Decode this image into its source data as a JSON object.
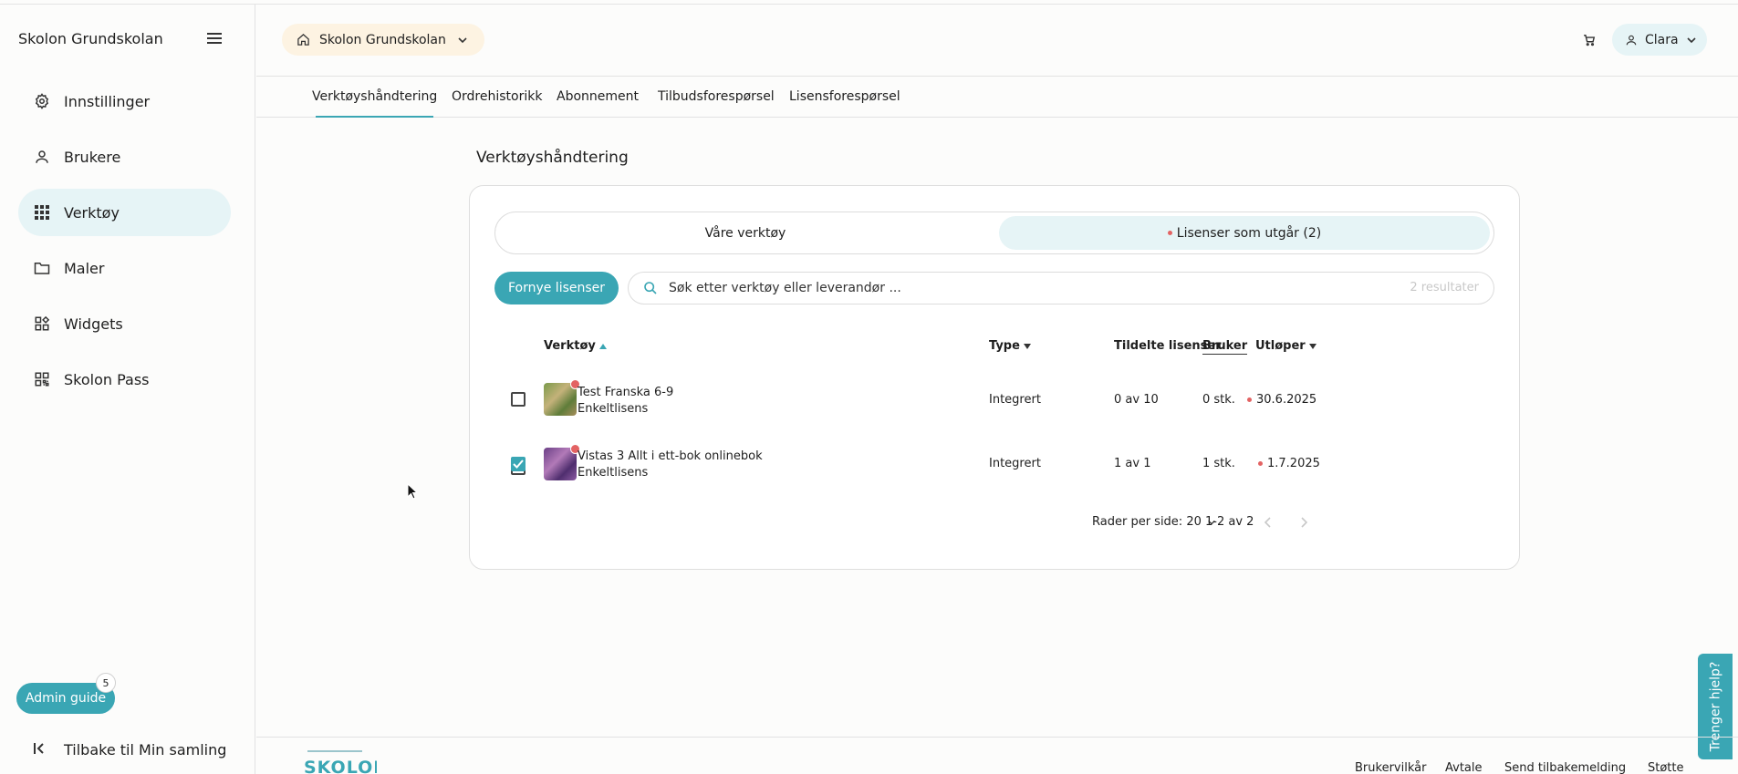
{
  "sidebar": {
    "brand": "Skolon Grundskolan",
    "items": [
      {
        "label": "Innstillinger",
        "icon": "gear-icon"
      },
      {
        "label": "Brukere",
        "icon": "user-icon"
      },
      {
        "label": "Verktøy",
        "icon": "grid-icon",
        "active": true
      },
      {
        "label": "Maler",
        "icon": "folder-icon"
      },
      {
        "label": "Widgets",
        "icon": "widgets-icon"
      },
      {
        "label": "Skolon Pass",
        "icon": "qr-icon"
      }
    ],
    "admin_guide_label": "Admin guide",
    "admin_guide_badge": "5",
    "back_label": "Tilbake til Min samling"
  },
  "header": {
    "school_label": "Skolon Grundskolan",
    "user_label": "Clara"
  },
  "tabs": [
    {
      "label": "Verktøyshåndtering",
      "active": true
    },
    {
      "label": "Ordrehistorikk"
    },
    {
      "label": "Abonnement"
    },
    {
      "label": "Tilbudsforespørsel"
    },
    {
      "label": "Lisensforespørsel"
    }
  ],
  "main": {
    "title": "Verktøyshåndtering",
    "segments": [
      "Våre verktøy",
      "Lisenser som utgår (2)"
    ],
    "renew_button": "Fornye lisenser",
    "search_placeholder": "Søk etter verktøy eller leverandør ...",
    "result_count": "2 resultater",
    "columns": {
      "tool": "Verktøy",
      "type": "Type",
      "assigned": "Tildelte lisenser",
      "user": "Bruker",
      "expires": "Utløper"
    },
    "rows": [
      {
        "name": "Test Franska 6-9",
        "license": "Enkeltlisens",
        "type": "Integrert",
        "assigned": "0 av 10",
        "users": "0 stk.",
        "expires": "30.6.2025",
        "checked": false
      },
      {
        "name": "Vistas 3 Allt i ett-bok onlinebok",
        "license": "Enkeltlisens",
        "type": "Integrert",
        "assigned": "1 av 1",
        "users": "1 stk.",
        "expires": "1.7.2025",
        "checked": true
      }
    ],
    "pagination": {
      "rows_per_page": "Rader per side: 20",
      "range": "1-2 av 2"
    }
  },
  "help_label": "Trenger hjelp?",
  "footer": {
    "links": [
      "Brukervilkår",
      "Avtale",
      "Send tilbakemelding",
      "Støtte"
    ]
  },
  "colors": {
    "accent": "#3aa6b4",
    "accent_light": "#e6f4f6",
    "school_pill": "#fdf3e2",
    "alert": "#e36363"
  }
}
